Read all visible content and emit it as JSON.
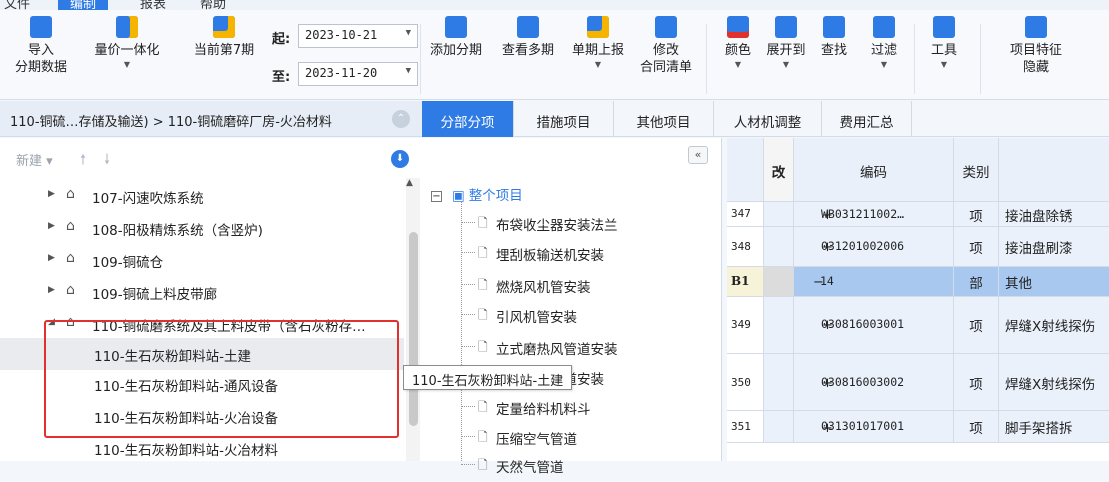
{
  "menu": {
    "items": [
      "文件",
      "编制",
      "报表",
      "帮助"
    ],
    "active": "编制"
  },
  "ribbon": {
    "import": {
      "line1": "导入",
      "line2": "分期数据"
    },
    "quantity_price": "量价一体化",
    "current_period": "当前第7期",
    "start_label": "起:",
    "start_date": "2023-10-21",
    "end_label": "至:",
    "end_date": "2023-11-20",
    "add_period": "添加分期",
    "view_periods": "查看多期",
    "single_report": "单期上报",
    "modify": {
      "line1": "修改",
      "line2": "合同清单"
    },
    "color": "颜色",
    "expand_to": "展开到",
    "find": "查找",
    "filter": "过滤",
    "tools": "工具",
    "hide_features": {
      "line1": "项目特征",
      "line2": "隐藏"
    }
  },
  "breadcrumb": "110-铜硫…存储及输送) > 110-铜硫磨碎厂房-火冶材料",
  "left_panel": {
    "new_label": "新建",
    "tree": [
      {
        "label": "107-闪速吹炼系统",
        "level": 1
      },
      {
        "label": "108-阳极精炼系统（含竖炉)",
        "level": 1
      },
      {
        "label": "109-铜硫仓",
        "level": 1
      },
      {
        "label": "109-铜硫上料皮带廊",
        "level": 1
      },
      {
        "label": "110-铜硫磨系统及其上料皮带（含石灰粉存…",
        "level": 1
      },
      {
        "label": "110-生石灰粉卸料站-土建",
        "level": 2
      },
      {
        "label": "110-生石灰粉卸料站-通风设备",
        "level": 2
      },
      {
        "label": "110-生石灰粉卸料站-火冶设备",
        "level": 2
      },
      {
        "label": "110-生石灰粉卸料站-火冶材料",
        "level": 2
      }
    ],
    "tooltip": "110-生石灰粉卸料站-土建"
  },
  "tabs": [
    "分部分项",
    "措施项目",
    "其他项目",
    "人材机调整",
    "费用汇总"
  ],
  "middle_panel": {
    "root": "整个项目",
    "items": [
      "布袋收尘器安装法兰",
      "埋刮板输送机安装",
      "燃烧风机管安装",
      "引风机管安装",
      "立式磨热风管道安装",
      "磨机喷水管道安装",
      "定量给料机料斗",
      "压缩空气管道",
      "天然气管道"
    ]
  },
  "grid": {
    "headers": {
      "change": "改",
      "code": "编码",
      "type": "类别"
    },
    "rows": [
      {
        "num": "347",
        "code": "WB031211002…",
        "type": "项",
        "name": "接油盘除锈"
      },
      {
        "num": "348",
        "code": "031201002006",
        "type": "项",
        "name": "接油盘刷漆"
      },
      {
        "num": "B1",
        "code": "14",
        "type": "部",
        "name": "其他"
      },
      {
        "num": "349",
        "code": "030816003001",
        "type": "项",
        "name": "焊缝X射线探伤"
      },
      {
        "num": "350",
        "code": "030816003002",
        "type": "项",
        "name": "焊缝X射线探伤"
      },
      {
        "num": "351",
        "code": "031301017001",
        "type": "项",
        "name": "脚手架搭拆"
      }
    ]
  }
}
